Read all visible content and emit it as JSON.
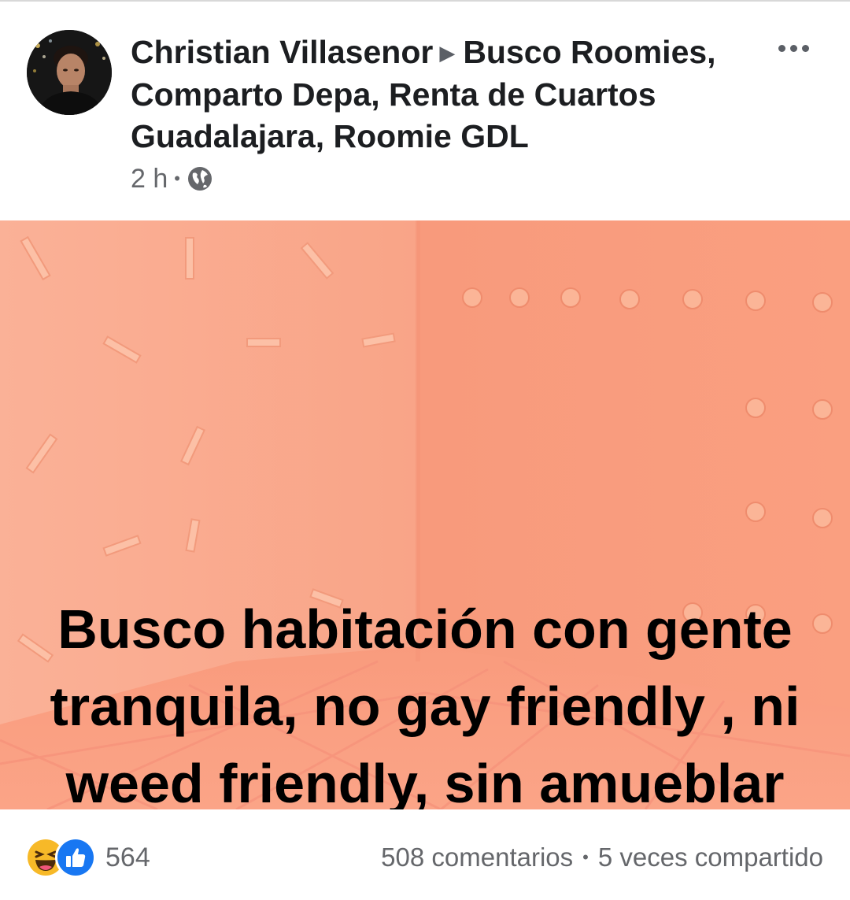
{
  "post": {
    "author": "Christian Villasenor",
    "group": "Busco Roomies, Comparto Depa, Renta de Cuartos Guadalajara, Roomie GDL",
    "time": "2 h",
    "separator": "•",
    "privacy_icon": "globe-icon",
    "more_icon": "more-options-icon",
    "body_text": "Busco habitación con gente tranquila, no gay friendly , ni weed friendly, sin amueblar",
    "background_color": "#f9a184"
  },
  "footer": {
    "reaction_icons": [
      "haha-icon",
      "like-icon"
    ],
    "reaction_count": "564",
    "comments": "508 comentarios",
    "separator": "•",
    "shares": "5 veces compartido"
  },
  "colors": {
    "text_primary": "#1c1e21",
    "text_secondary": "#65676b",
    "like_blue": "#1877f2",
    "haha_yellow": "#f7b928"
  }
}
